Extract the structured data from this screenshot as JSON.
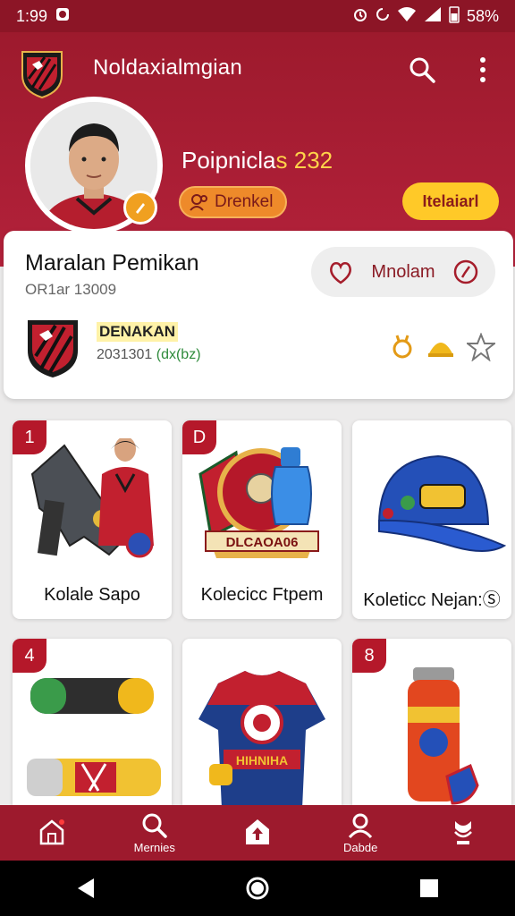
{
  "status_bar": {
    "time": "1:99",
    "battery": "58%"
  },
  "app": {
    "title": "Noldaxialmgian"
  },
  "profile": {
    "points_label": "Poipnicla",
    "points_value": "s 232",
    "rank_chip": "Drenkel",
    "action_button": "Itelaiarl",
    "name": "Maralan Pemikan",
    "id": "OR1ar 13009",
    "follow_label": "Mnolam"
  },
  "club": {
    "name": "DENAKAN",
    "meta": "2031301",
    "meta_tag": "(dx(bz)"
  },
  "collections": [
    {
      "num": "1",
      "label": "Kolale Sapo"
    },
    {
      "num": "D",
      "label": "Kolecicc Ftpem",
      "emblem_text": "DLCAOA06"
    },
    {
      "num": "",
      "label": "Koleticc Nejan:Ⓢ"
    },
    {
      "num": "4",
      "label": ""
    },
    {
      "num": "",
      "label": "",
      "jersey_text": "HIHNIHA"
    },
    {
      "num": "8",
      "label": ""
    }
  ],
  "bottom_nav": [
    {
      "icon": "home-icon",
      "label": ""
    },
    {
      "icon": "search-icon",
      "label": "Mernies"
    },
    {
      "icon": "upload-home-icon",
      "label": ""
    },
    {
      "icon": "profile-icon",
      "label": "Dabde"
    },
    {
      "icon": "trophy-icon",
      "label": ""
    }
  ],
  "colors": {
    "primary": "#9d1a2d",
    "accent": "#ffc928",
    "chip": "#ee8a2a"
  }
}
